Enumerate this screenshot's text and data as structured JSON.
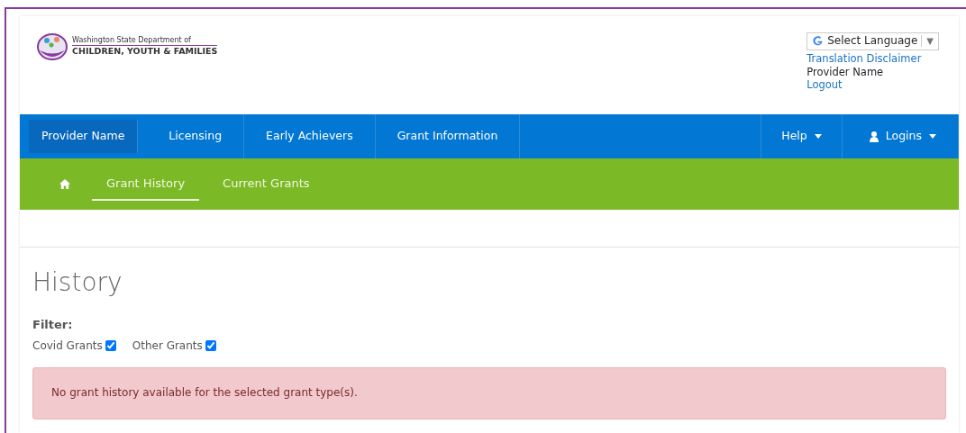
{
  "header": {
    "logo_lines": [
      "Washington State Department of",
      "CHILDREN, YOUTH & FAMILIES"
    ],
    "language_select": {
      "label": "Select Language",
      "caret": "▼"
    },
    "links": [
      {
        "text": "Translation Disclaimer",
        "kind": "link"
      },
      {
        "text": "Provider Name",
        "kind": "text"
      },
      {
        "text": "Logout",
        "kind": "link"
      }
    ]
  },
  "main_nav": {
    "items": [
      {
        "label": "Provider Name",
        "selected": true
      },
      {
        "label": "Licensing",
        "selected": false
      },
      {
        "label": "Early Achievers",
        "selected": false
      },
      {
        "label": "Grant Information",
        "selected": false
      }
    ],
    "right_items": [
      {
        "label": "Help",
        "kind": "menu"
      },
      {
        "label": "Logins",
        "kind": "account"
      }
    ]
  },
  "sub_nav": {
    "items": [
      {
        "label": "Grant History",
        "selected": true
      },
      {
        "label": "Current Grants",
        "selected": false
      }
    ]
  },
  "heading": "History",
  "filter": {
    "label": "Filter:",
    "options": [
      {
        "label": "Covid Grants",
        "checked": true
      },
      {
        "label": "Other Grants",
        "checked": true
      }
    ]
  },
  "alert": "No grant history available for the selected grant type(s)."
}
